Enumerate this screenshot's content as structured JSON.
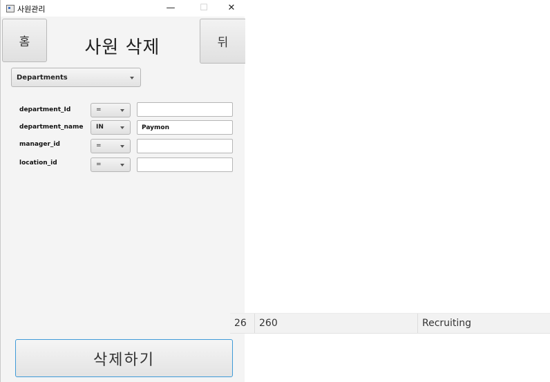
{
  "window": {
    "title": "사원관리",
    "minimize_glyph": "—",
    "maximize_glyph": "☐",
    "close_glyph": "✕"
  },
  "header": {
    "home_label": "홈",
    "back_label": "뒤",
    "page_title": "사원 삭제"
  },
  "table_select": {
    "value": "Departments"
  },
  "filters": [
    {
      "label": "department_Id",
      "operator": "=",
      "value": ""
    },
    {
      "label": "department_name",
      "operator": "IN",
      "value": "Paymon"
    },
    {
      "label": "manager_id",
      "operator": "=",
      "value": ""
    },
    {
      "label": "location_id",
      "operator": "=",
      "value": ""
    }
  ],
  "delete_button": {
    "label": "삭제하기"
  },
  "result_row": {
    "col1": "26",
    "col2": "260",
    "col3": "Recruiting"
  },
  "icons": {
    "app": "app-window-icon",
    "dropdown": "chevron-down-icon"
  },
  "colors": {
    "accent_border": "#3d9ad8",
    "panel_bg": "#f4f4f4"
  }
}
